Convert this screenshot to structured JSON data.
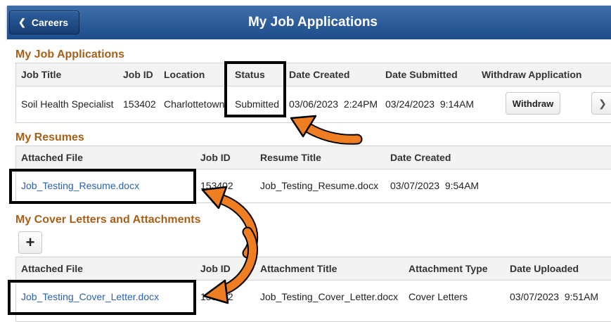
{
  "header": {
    "back_label": "Careers",
    "title": "My Job Applications"
  },
  "applications": {
    "section_title": "My Job Applications",
    "columns": [
      "Job Title",
      "Job ID",
      "Location",
      "Status",
      "Date Created",
      "Date Submitted",
      "Withdraw Application"
    ],
    "rows": [
      {
        "job_title": "Soil Health Specialist",
        "job_id": "153402",
        "location": "Charlottetown",
        "status": "Submitted",
        "date_created": "03/06/2023  2:24PM",
        "date_submitted": "03/24/2023  9:14AM",
        "withdraw_label": "Withdraw"
      }
    ]
  },
  "resumes": {
    "section_title": "My Resumes",
    "columns": [
      "Attached File",
      "Job ID",
      "Resume Title",
      "Date Created"
    ],
    "rows": [
      {
        "file": "Job_Testing_Resume.docx",
        "job_id": "153402",
        "resume_title": "Job_Testing_Resume.docx",
        "date_created": "03/07/2023  9:54AM"
      }
    ]
  },
  "cover_letters": {
    "section_title": "My Cover Letters and Attachments",
    "add_icon": "plus-icon",
    "columns": [
      "Attached File",
      "Job ID",
      "Attachment Title",
      "Attachment Type",
      "Date Uploaded"
    ],
    "rows": [
      {
        "file": "Job_Testing_Cover_Letter.docx",
        "job_id": "153402",
        "attachment_title": "Job_Testing_Cover_Letter.docx",
        "attachment_type": "Cover Letters",
        "date_uploaded": "03/07/2023  9:51AM"
      }
    ]
  },
  "colors": {
    "header": "#1d4d8a",
    "section_title": "#a85f17",
    "link": "#2a62b0",
    "arrow": "#ef7d22",
    "callout_border": "#000000"
  },
  "icons": [
    "chevron-left-icon",
    "chevron-right-icon",
    "plus-icon"
  ]
}
